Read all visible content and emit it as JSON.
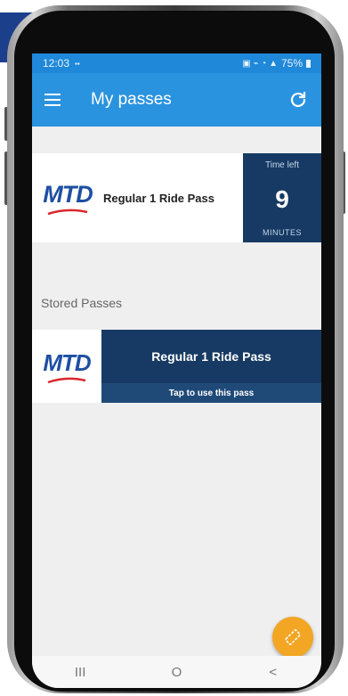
{
  "status_bar": {
    "time": "12:03",
    "battery": "75%"
  },
  "app_bar": {
    "title": "My passes",
    "menu_icon": "hamburger-menu-icon",
    "refresh_icon": "refresh-icon"
  },
  "active_pass": {
    "logo_text": "MTD",
    "name": "Regular  1 Ride Pass",
    "time_left_label": "Time left",
    "time_left_value": "9",
    "time_left_unit": "MINUTES"
  },
  "stored_section": {
    "title": "Stored Passes"
  },
  "stored_pass": {
    "logo_text": "MTD",
    "name": "Regular  1 Ride Pass",
    "action_label": "Tap to use this pass"
  },
  "fab": {
    "icon": "ticket-icon"
  },
  "nav_bar": {
    "recents": "III",
    "home": "O",
    "back": "<"
  },
  "colors": {
    "app_bar": "#2a93df",
    "pass_dark": "#163a63",
    "fab": "#f2a623",
    "logo_blue": "#1d4fa3",
    "logo_red": "#d9272e"
  }
}
